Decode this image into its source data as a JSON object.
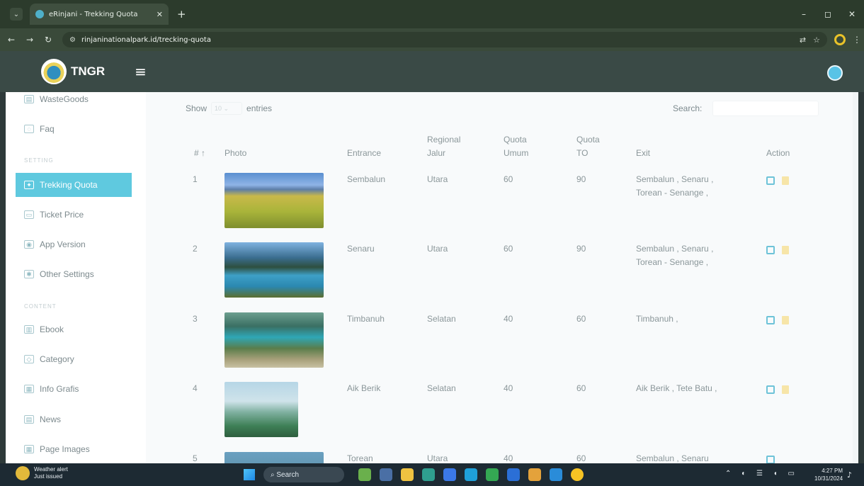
{
  "browser": {
    "tab_title": "eRinjani - Trekking Quota",
    "url": "rinjaninationalpark.id/trecking-quota"
  },
  "app": {
    "brand": "TNGR",
    "menu_icon": "hamburger-icon",
    "avatar_icon": "user-avatar-icon"
  },
  "sidebar": {
    "items_top": [
      {
        "label": "WasteGoods",
        "icon": "box-icon"
      },
      {
        "label": "Faq",
        "icon": "chat-icon"
      }
    ],
    "section_settings": "SETTING",
    "items_settings": [
      {
        "label": "Trekking Quota",
        "icon": "hiker-icon",
        "active": true
      },
      {
        "label": "Ticket Price",
        "icon": "ticket-icon"
      },
      {
        "label": "App Version",
        "icon": "android-icon"
      },
      {
        "label": "Other Settings",
        "icon": "gear-icon"
      }
    ],
    "section_content": "CONTENT",
    "items_content": [
      {
        "label": "Ebook",
        "icon": "book-icon"
      },
      {
        "label": "Category",
        "icon": "tag-icon"
      },
      {
        "label": "Info Grafis",
        "icon": "image-icon"
      },
      {
        "label": "News",
        "icon": "news-icon"
      },
      {
        "label": "Page Images",
        "icon": "image-icon"
      }
    ]
  },
  "table_controls": {
    "show_label": "Show",
    "entries_value": "10",
    "entries_label": "entries",
    "search_label": "Search:"
  },
  "table": {
    "columns": [
      "#",
      "Photo",
      "Entrance",
      "Regional Jalur",
      "Quota Umum",
      "Quota TO",
      "Exit",
      "Action"
    ],
    "col_hash": "# ↑",
    "col_photo": "Photo",
    "col_entrance": "Entrance",
    "col_regional_1": "Regional",
    "col_regional_2": "Jalur",
    "col_umum_1": "Quota",
    "col_umum_2": "Umum",
    "col_to_1": "Quota",
    "col_to_2": "TO",
    "col_exit": "Exit",
    "col_action": "Action",
    "rows": [
      {
        "no": "1",
        "entrance": "Sembalun",
        "regional": "Utara",
        "quota_umum": "60",
        "quota_to": "90",
        "exit_1": "Sembalun , Senaru ,",
        "exit_2": "Torean - Senange ,"
      },
      {
        "no": "2",
        "entrance": "Senaru",
        "regional": "Utara",
        "quota_umum": "60",
        "quota_to": "90",
        "exit_1": "Sembalun , Senaru ,",
        "exit_2": "Torean - Senange ,"
      },
      {
        "no": "3",
        "entrance": "Timbanuh",
        "regional": "Selatan",
        "quota_umum": "40",
        "quota_to": "60",
        "exit_1": "Timbanuh ,",
        "exit_2": ""
      },
      {
        "no": "4",
        "entrance": "Aik Berik",
        "regional": "Selatan",
        "quota_umum": "40",
        "quota_to": "60",
        "exit_1": "Aik Berik , Tete Batu ,",
        "exit_2": ""
      },
      {
        "no": "5",
        "entrance": "Torean",
        "regional": "Utara",
        "quota_umum": "40",
        "quota_to": "60",
        "exit_1": "Sembalun , Senaru",
        "exit_2": ""
      }
    ]
  },
  "taskbar": {
    "weather_title": "Weather alert",
    "weather_sub": "Just issued",
    "search_label": "Search",
    "time": "4:27 PM",
    "date": "10/31/2024"
  }
}
